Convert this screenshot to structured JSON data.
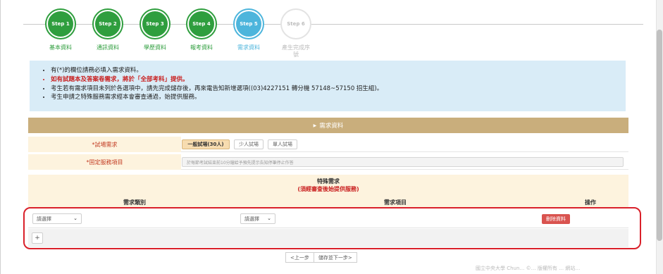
{
  "steps": [
    {
      "circle": "Step 1",
      "label": "基本資料",
      "state": "done"
    },
    {
      "circle": "Step 2",
      "label": "通訊資料",
      "state": "done"
    },
    {
      "circle": "Step 3",
      "label": "學歷資料",
      "state": "done"
    },
    {
      "circle": "Step 4",
      "label": "報考資料",
      "state": "done"
    },
    {
      "circle": "Step 5",
      "label": "需求資料",
      "state": "active"
    },
    {
      "circle": "Step 6",
      "label": "產生完成序號",
      "state": "todo"
    }
  ],
  "notice": {
    "line1": "有(*)的欄位請務必填入需求資料。",
    "line2": "如有試題本及答案卷需求，將於「全部考科」提供。",
    "line3": "考生若有需求項目未列於各選項中，請先完成儲存後，再來電告知新增選項((03)4227151 轉分機 57148~57150 招生組)。",
    "line4": "考生申請之特殊服務需求經本會審查通過，始提供服務。"
  },
  "section": {
    "title": "需求資料",
    "exam_room": {
      "label": "*試場需求",
      "options": [
        "一般試場(30人)",
        "少人試場",
        "單人試場"
      ]
    },
    "fixed_service": {
      "label": "*固定服務項目",
      "value": "於每節考試結束前10分鐘給予預先提示告知停筆停止作答"
    },
    "special": {
      "title": "特殊需求",
      "subtitle": "(須經審查後始提供服務)",
      "col_category": "需求類別",
      "col_item": "需求項目",
      "col_action": "操作",
      "row": {
        "category_value": "請選擇",
        "item_value": "請選擇",
        "delete_label": "刪除資料"
      },
      "add_label": "+"
    }
  },
  "nav": {
    "prev": "<上一步",
    "next": "儲存並下一步>"
  },
  "footer_text": "國立中央大學 Chun… ©… 版權所有 … 網站…"
}
